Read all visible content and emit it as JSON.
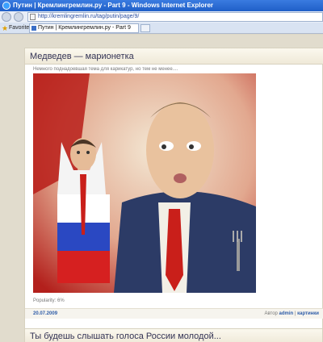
{
  "window": {
    "title": "Путин | Кремлингремлин.ру - Part 9 - Windows Internet Explorer"
  },
  "browser": {
    "address": "http://kremlingremlin.ru/tag/putin/page/9/",
    "favorites_label": "Favorites",
    "tab_label": "Путин | Кремлингремлин.ру - Part 9"
  },
  "post": {
    "title": "Медведев — марионетка",
    "teaser": "Немного поднадоевшая тема для карикатур, но тем не менее....",
    "popularity": "Popularity: 6%",
    "date": "20.07.2009",
    "meta_prefix": "Автор",
    "author": "admin",
    "separator": "|",
    "category": "картинки"
  },
  "next_post": {
    "title": "Ты будешь слышать голоса России молодой..."
  },
  "colors": {
    "link": "#2e5ca8",
    "titlebar": "#1f5fc8"
  }
}
